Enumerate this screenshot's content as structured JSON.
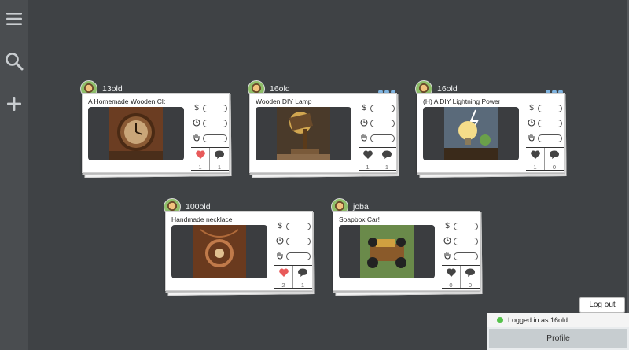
{
  "sidebar": {
    "items": [
      {
        "icon": "menu-icon"
      },
      {
        "icon": "search-icon"
      },
      {
        "icon": "plus-icon"
      }
    ]
  },
  "posts": [
    {
      "author": "13old",
      "title": "A Homemade Wooden Clock",
      "likes": "1",
      "comments": "1",
      "liked": true,
      "has_menu": false,
      "art": "clock"
    },
    {
      "author": "16old",
      "title": "Wooden DIY Lamp",
      "likes": "1",
      "comments": "1",
      "liked": false,
      "has_menu": true,
      "art": "lamp"
    },
    {
      "author": "16old",
      "title": "(H) A DIY Lightning Power",
      "likes": "1",
      "comments": "0",
      "liked": false,
      "has_menu": true,
      "art": "bulb"
    },
    {
      "author": "100old",
      "title": "Handmade necklace",
      "likes": "2",
      "comments": "1",
      "liked": true,
      "has_menu": false,
      "art": "necklace"
    },
    {
      "author": "joba",
      "title": "Soapbox Car!",
      "likes": "0",
      "comments": "0",
      "liked": false,
      "has_menu": false,
      "art": "car"
    }
  ],
  "meta_icons": [
    "dollar-icon",
    "clock-icon",
    "hand-icon"
  ],
  "colors": {
    "like_active": "#e85a5a",
    "like_inactive": "#444444",
    "menu_dots": "#7fb4e0",
    "online": "#55c24a"
  },
  "session": {
    "logout_label": "Log out",
    "status_text": "Logged in as 16old",
    "profile_label": "Profile"
  }
}
